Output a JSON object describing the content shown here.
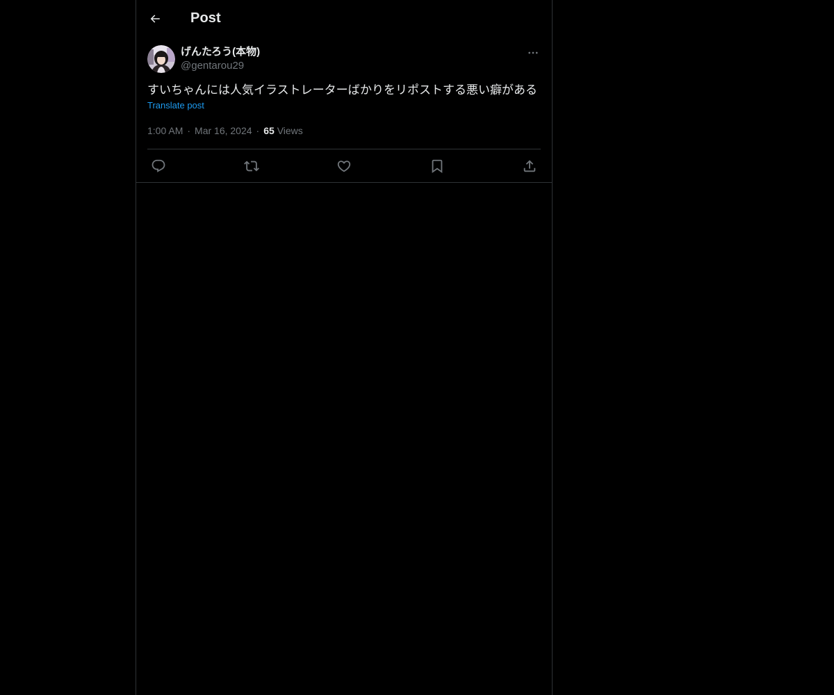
{
  "header": {
    "title": "Post",
    "back_icon": "arrow-left-icon"
  },
  "post": {
    "author": {
      "display_name": "げんたろう(本物)",
      "handle": "@gentarou29"
    },
    "text": "すいちゃんには人気イラストレーターばかりをリポストする悪い癖がある",
    "translate_label": "Translate post",
    "time": "1:00 AM",
    "date": "Mar 16, 2024",
    "views_count": "65",
    "views_label": "Views",
    "separator": "·"
  },
  "actions": [
    "reply-icon",
    "repost-icon",
    "like-icon",
    "bookmark-icon",
    "share-icon"
  ],
  "colors": {
    "background": "#000000",
    "text": "#e7e9ea",
    "secondary": "#71767b",
    "link": "#1d9bf0",
    "border": "#2f3336"
  }
}
